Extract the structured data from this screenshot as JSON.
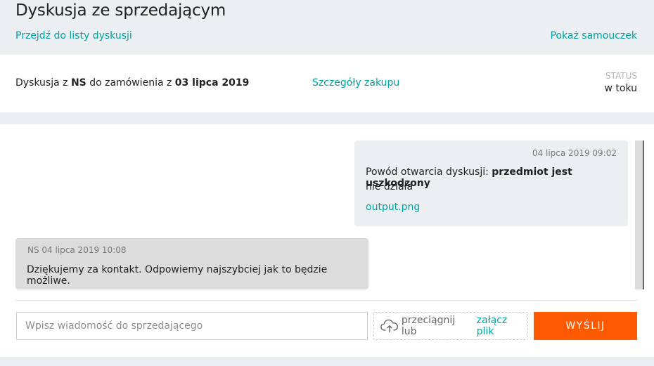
{
  "header": {
    "title": "Dyskusja ze sprzedającym",
    "back_link": "Przejdź do listy dyskusji",
    "tutorial_link": "Pokaż samouczek"
  },
  "info": {
    "prefix": "Dyskusja z",
    "seller": "NS",
    "middle": "do zamówienia z",
    "order_date": "03 lipca 2019",
    "details_link": "Szczegóły zakupu",
    "status_label": "STATUS",
    "status_value": "w toku"
  },
  "messages": [
    {
      "timestamp": "04 lipca 2019 09:02",
      "reason_label": "Powód otwarcia dyskusji:",
      "reason_value": "przedmiot jest uszkodzony",
      "body": "nie działa",
      "attachment": "output.png"
    },
    {
      "author": "NS",
      "timestamp": "04 lipca 2019 10:08",
      "body": "Dziękujemy za kontakt. Odpowiemy najszybciej jak to będzie możliwe."
    }
  ],
  "composer": {
    "placeholder": "Wpisz wiadomość do sprzedającego",
    "value": "",
    "drop_text": "przeciągnij lub",
    "attach_link": "załącz plik",
    "send_label": "WYŚLIJ"
  },
  "colors": {
    "accent": "#00a3a3",
    "send": "#ff5a00",
    "background": "#eceff1"
  }
}
